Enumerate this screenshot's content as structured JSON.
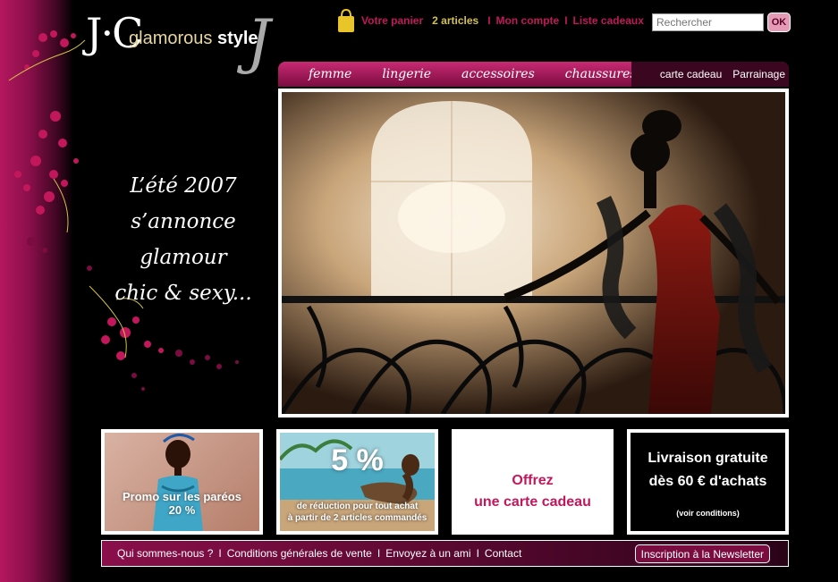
{
  "logo": {
    "monogram": "J·C",
    "word1": "glamorous",
    "word2": "style",
    "flourish": "J"
  },
  "top_links": {
    "cart": "Votre panier",
    "count": "2 articles",
    "account": "Mon compte",
    "gift_list": "Liste cadeaux",
    "separator": "I"
  },
  "search": {
    "placeholder": "Rechercher",
    "button": "OK"
  },
  "nav": {
    "main": [
      "femme",
      "lingerie",
      "accessoires",
      "chaussures"
    ],
    "secondary": [
      "carte cadeau",
      "Parrainage"
    ]
  },
  "slogan": [
    "L’été 2007",
    "s’annonce",
    "glamour",
    "chic & sexy..."
  ],
  "promos": {
    "pareos": {
      "line1": "Promo sur les paréos",
      "line2": "20 %"
    },
    "discount": {
      "big": "5 %",
      "line1": "de réduction pour tout achat",
      "line2": "à partir de 2 articles commandés"
    },
    "gift": {
      "line1": "Offrez",
      "line2": "une carte cadeau"
    },
    "shipping": {
      "line1": "Livraison gratuite",
      "line2": "dès 60 € d'achats",
      "conditions": "(voir conditions)"
    }
  },
  "footer": {
    "links": [
      "Qui sommes-nous ?",
      "Conditions générales de vente",
      "Envoyez à un ami",
      "Contact"
    ],
    "separator": "I",
    "newsletter": "Inscription à la Newsletter"
  },
  "colors": {
    "accent": "#c2185b",
    "dark_magenta": "#7a0c40",
    "gold": "#d4c14a"
  },
  "icons": {
    "cart": "shopping-bag-icon"
  }
}
